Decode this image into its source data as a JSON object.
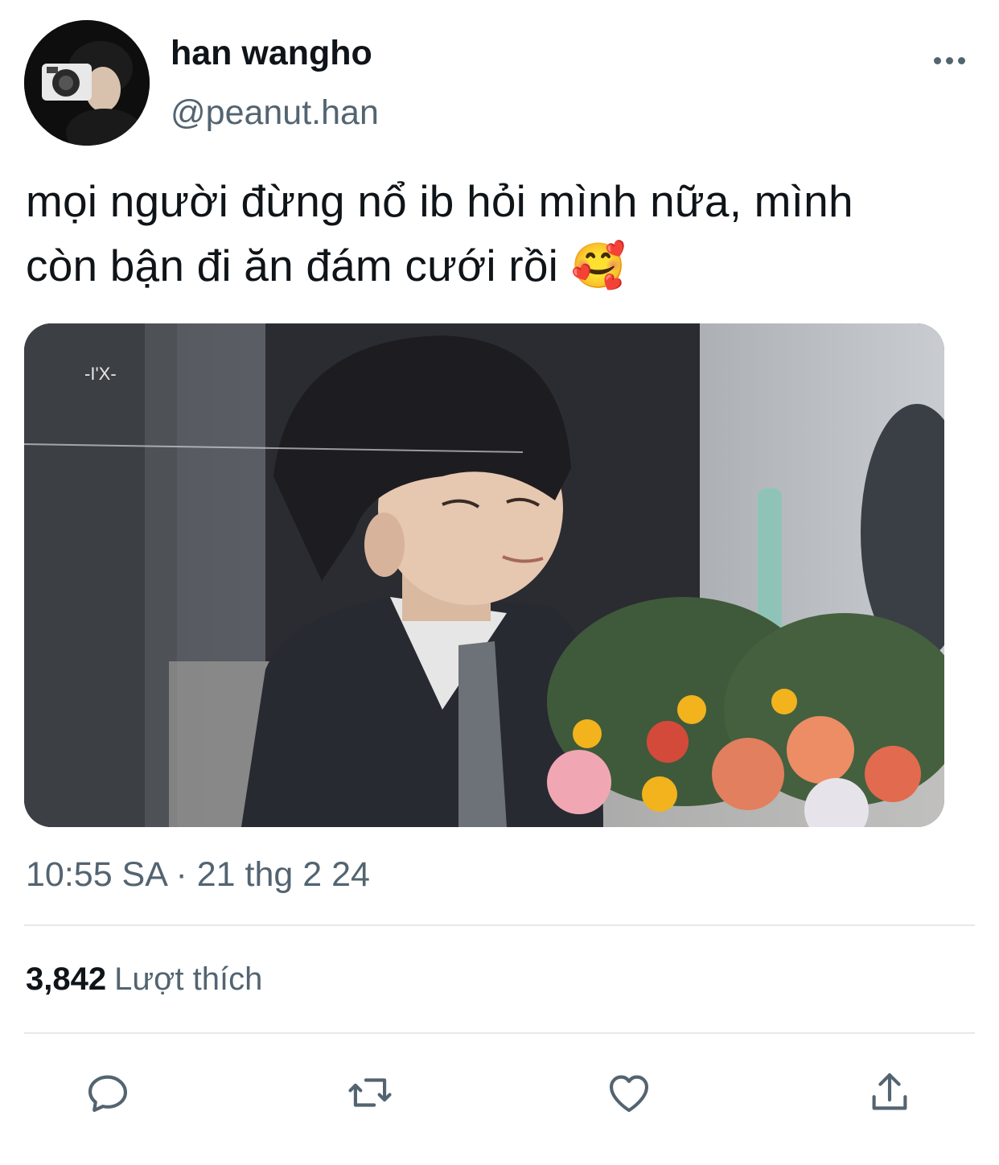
{
  "tweet": {
    "author_name": "han wangho",
    "handle": "@peanut.han",
    "text_line1": "mọi người đừng nổ ib hỏi mình nữa, mình",
    "text_line2": "còn bận đi ăn đám cưới rồi",
    "emoji": "🥰",
    "media_watermark": "-I'X-",
    "timestamp": "10:55 SA · 21 thg 2 24",
    "likes_count": "3,842",
    "likes_label": "Lượt thích"
  },
  "icons": {
    "more": "more-options-icon",
    "reply": "reply-icon",
    "retweet": "retweet-icon",
    "like": "like-icon",
    "share": "share-icon"
  },
  "colors": {
    "text_primary": "#0f1419",
    "text_secondary": "#536471",
    "divider": "#e6e9ec",
    "background": "#ffffff"
  }
}
